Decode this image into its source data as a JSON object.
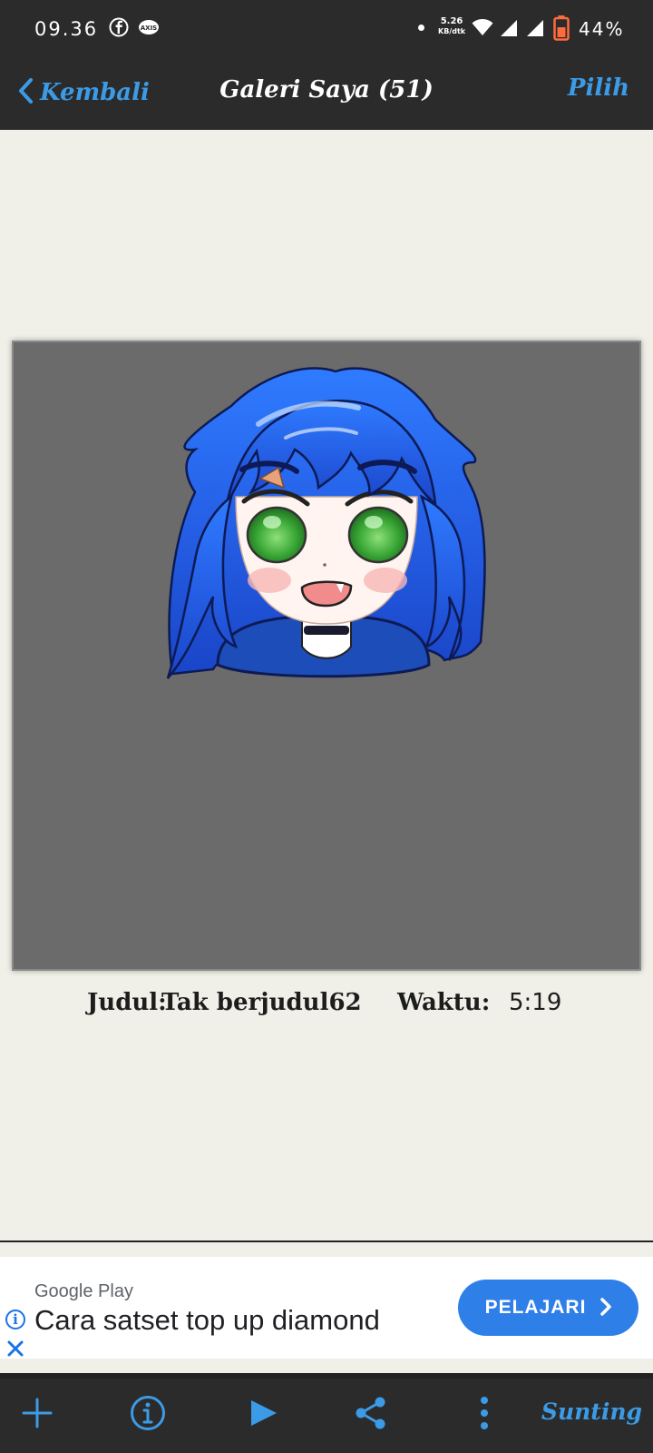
{
  "status_bar": {
    "time": "09.36",
    "net_speed_value": "5.26",
    "net_speed_unit": "KB/dtk",
    "battery": "44%"
  },
  "navbar": {
    "back_label": "Kembali",
    "title": "Galeri Saya (51)",
    "select_label": "Pilih"
  },
  "artwork_info": {
    "title_label": "Judul:",
    "title_value": "Tak berjudul62",
    "time_label": "Waktu:",
    "time_value": "5:19"
  },
  "ad": {
    "source": "Google Play",
    "headline": "Cara satset top up diamond",
    "cta": "PELAJARI"
  },
  "toolbar": {
    "edit_label": "Sunting"
  },
  "colors": {
    "accent": "#3b9be6",
    "bar_bg": "#2b2b2b",
    "page_bg": "#f1f0e8",
    "canvas_bg": "#6b6b6b",
    "ad_cta": "#2f7fe8"
  }
}
